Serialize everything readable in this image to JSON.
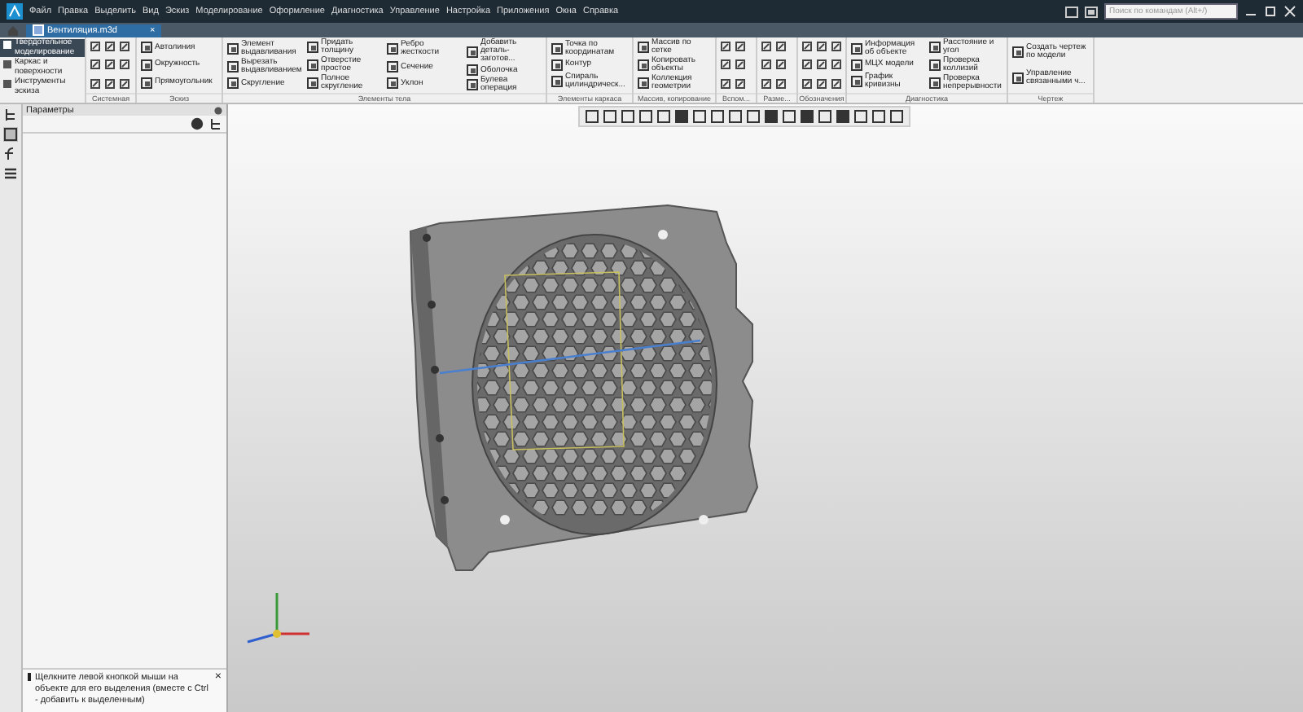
{
  "window": {
    "menu": [
      "Файл",
      "Правка",
      "Выделить",
      "Вид",
      "Эскиз",
      "Моделирование",
      "Оформление",
      "Диагностика",
      "Управление",
      "Настройка",
      "Приложения",
      "Окна",
      "Справка"
    ],
    "search": {
      "placeholder": "Поиск по командам (Alt+/)"
    }
  },
  "tabs": [
    {
      "label": "Вентиляция.m3d",
      "selected": true,
      "close": "×"
    }
  ],
  "modes": [
    {
      "label": "Твердотельное моделирование",
      "selected": true
    },
    {
      "label": "Каркас и поверхности",
      "selected": false
    },
    {
      "label": "Инструменты эскиза",
      "selected": false
    }
  ],
  "ribbon": [
    {
      "name": "Системная",
      "kind": "icons"
    },
    {
      "name": "Эскиз",
      "kind": "buttons",
      "columns": [
        [
          "Автолиния",
          "Окружность",
          "Прямоугольник"
        ]
      ]
    },
    {
      "name": "Элементы тела",
      "kind": "buttons",
      "columns": [
        [
          "Элемент выдавливания",
          "Вырезать выдавливанием",
          "Скругление"
        ],
        [
          "Придать толщину",
          "Отверстие простое",
          "Полное скругление"
        ],
        [
          "Ребро жесткости",
          "Сечение",
          "Уклон"
        ],
        [
          "Добавить деталь-заготов...",
          "Оболочка",
          "Булева операция"
        ]
      ]
    },
    {
      "name": "Элементы каркаса",
      "kind": "buttons",
      "columns": [
        [
          "Точка по координатам",
          "Контур",
          "Спираль цилиндрическ..."
        ]
      ]
    },
    {
      "name": "Массив, копирование",
      "kind": "buttons",
      "columns": [
        [
          "Массив по сетке",
          "Копировать объекты",
          "Коллекция геометрии"
        ]
      ]
    },
    {
      "name": "Вспом...",
      "kind": "icons"
    },
    {
      "name": "Разме...",
      "kind": "icons"
    },
    {
      "name": "Обозначения",
      "kind": "icons"
    },
    {
      "name": "Диагностика",
      "kind": "buttons",
      "columns": [
        [
          "Информация об объекте",
          "МЦХ модели",
          "График кривизны"
        ],
        [
          "Расстояние и угол",
          "Проверка коллизий",
          "Проверка непрерывности"
        ]
      ]
    },
    {
      "name": "Чертеж",
      "kind": "buttons",
      "columns": [
        [
          "Создать чертеж по модели",
          "Управление связанными ч..."
        ]
      ]
    }
  ],
  "panel": {
    "title": "Параметры"
  },
  "hint_close": "×",
  "hint": "Щелкните левой кнопкой мыши на объекте для его выделения (вместе с Ctrl - добавить к выделенным)"
}
